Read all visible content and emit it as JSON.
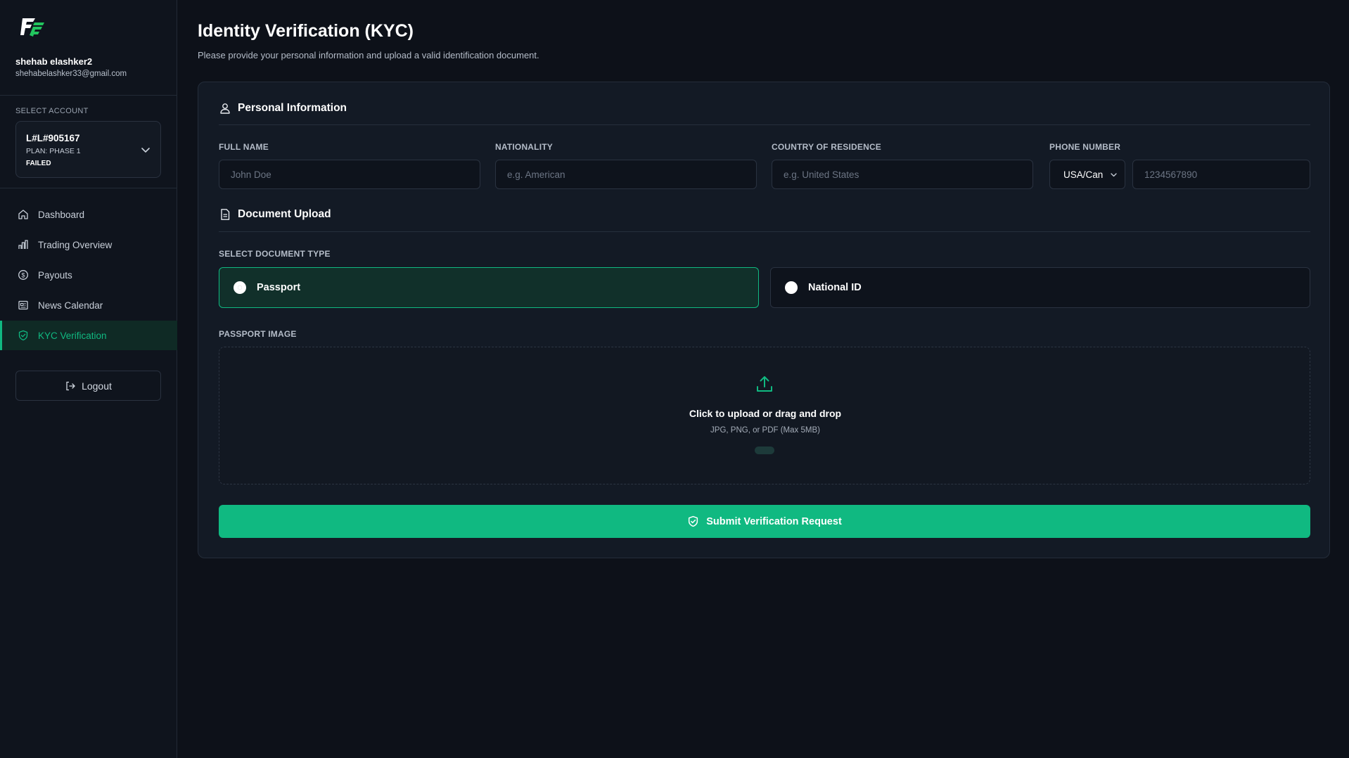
{
  "sidebar": {
    "user_name": "shehab elashker2",
    "user_email": "shehabelashker33@gmail.com",
    "select_account_label": "SELECT ACCOUNT",
    "account": {
      "id": "L#L#905167",
      "plan": "PLAN: PHASE 1",
      "status": "FAILED"
    },
    "nav": [
      {
        "label": "Dashboard",
        "icon": "home-icon",
        "active": false
      },
      {
        "label": "Trading Overview",
        "icon": "chart-icon",
        "active": false
      },
      {
        "label": "Payouts",
        "icon": "dollar-icon",
        "active": false
      },
      {
        "label": "News Calendar",
        "icon": "newspaper-icon",
        "active": false
      },
      {
        "label": "KYC Verification",
        "icon": "shield-check-icon",
        "active": true
      }
    ],
    "logout_label": "Logout"
  },
  "header": {
    "title": "Identity Verification (KYC)",
    "subtitle": "Please provide your personal information and upload a valid identification document."
  },
  "personal": {
    "section_title": "Personal Information",
    "full_name": {
      "label": "FULL NAME",
      "placeholder": "John Doe",
      "value": ""
    },
    "nationality": {
      "label": "NATIONALITY",
      "placeholder": "e.g. American",
      "value": ""
    },
    "country": {
      "label": "COUNTRY OF RESIDENCE",
      "placeholder": "e.g. United States",
      "value": ""
    },
    "phone": {
      "label": "PHONE NUMBER",
      "country_code": "USA/Can",
      "placeholder": "1234567890",
      "value": ""
    }
  },
  "document": {
    "section_title": "Document Upload",
    "type_label": "SELECT DOCUMENT TYPE",
    "options": [
      {
        "label": "Passport",
        "selected": true
      },
      {
        "label": "National ID",
        "selected": false
      }
    ],
    "image_label": "PASSPORT IMAGE",
    "upload_title": "Click to upload or drag and drop",
    "upload_hint": "JPG, PNG, or PDF (Max 5MB)"
  },
  "submit_label": "Submit Verification Request",
  "colors": {
    "accent": "#10b981",
    "background": "#0d1119",
    "card": "#131a25"
  }
}
